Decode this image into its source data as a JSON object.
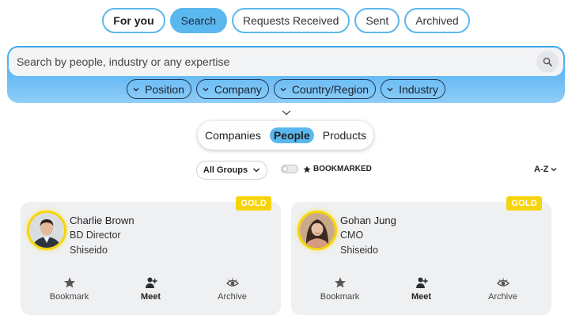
{
  "tabs": [
    {
      "label": "For you"
    },
    {
      "label": "Search"
    },
    {
      "label": "Requests Received"
    },
    {
      "label": "Sent"
    },
    {
      "label": "Archived"
    }
  ],
  "active_tab": "Search",
  "search": {
    "placeholder": "Search by people, industry or any expertise",
    "value": ""
  },
  "filters": [
    {
      "label": "Position"
    },
    {
      "label": "Company"
    },
    {
      "label": "Country/Region"
    },
    {
      "label": "Industry"
    }
  ],
  "segments": [
    {
      "label": "Companies"
    },
    {
      "label": "People"
    },
    {
      "label": "Products"
    }
  ],
  "active_segment": "People",
  "toolbar": {
    "groups_label": "All Groups",
    "bookmarked_label": "BOOKMARKED",
    "bookmarked_on": false,
    "sort_label": "A-Z"
  },
  "people": [
    {
      "name": "Charlie Brown",
      "role": "BD Director",
      "company": "Shiseido",
      "badge": "GOLD"
    },
    {
      "name": "Gohan Jung",
      "role": "CMO",
      "company": "Shiseido",
      "badge": "GOLD"
    }
  ],
  "card_actions": {
    "bookmark": "Bookmark",
    "meet": "Meet",
    "archive": "Archive"
  },
  "colors": {
    "accent": "#5bb8ee",
    "badge": "#f6d40a",
    "card_bg": "#eef0f2"
  }
}
